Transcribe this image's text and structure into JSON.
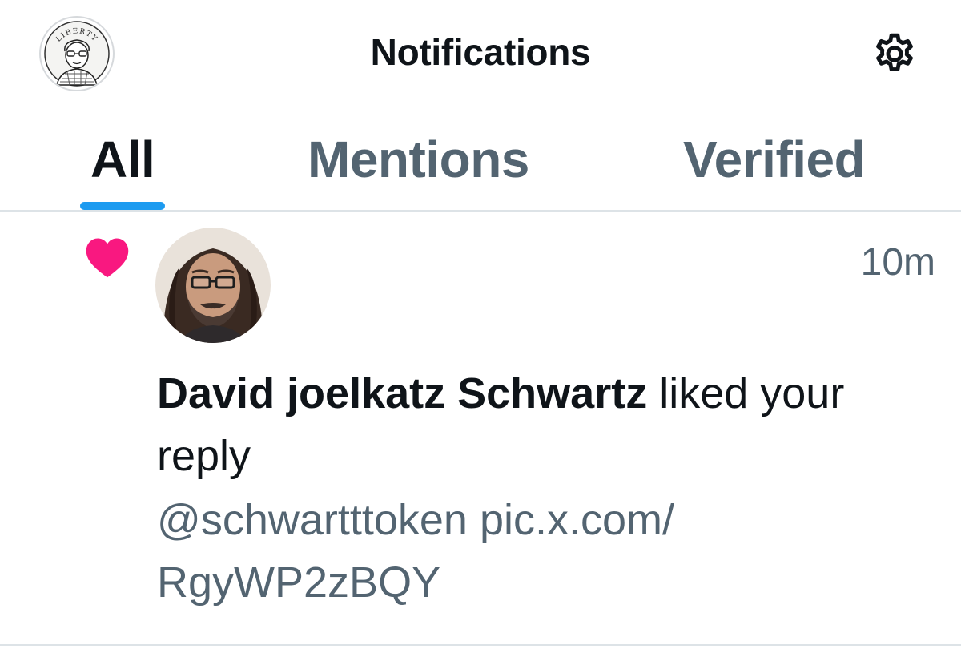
{
  "header": {
    "title": "Notifications",
    "profile_avatar": "profile-avatar",
    "settings_icon": "gear-icon",
    "avatar_badge_text": "LIBERTY"
  },
  "tabs": [
    {
      "label": "All",
      "active": true
    },
    {
      "label": "Mentions",
      "active": false
    },
    {
      "label": "Verified",
      "active": false
    }
  ],
  "colors": {
    "accent": "#1d9bf0",
    "like": "#f91880",
    "text_primary": "#0f1419",
    "text_secondary": "#536471",
    "divider": "#dde3e7"
  },
  "notifications": [
    {
      "type_icon": "heart-icon",
      "timestamp": "10m",
      "user_name": "David joelkatz Schwartz",
      "action_text": " liked your reply",
      "preview_line1": "@schwartttoken pic.x.com/",
      "preview_line2": "RgyWP2zBQY"
    }
  ]
}
